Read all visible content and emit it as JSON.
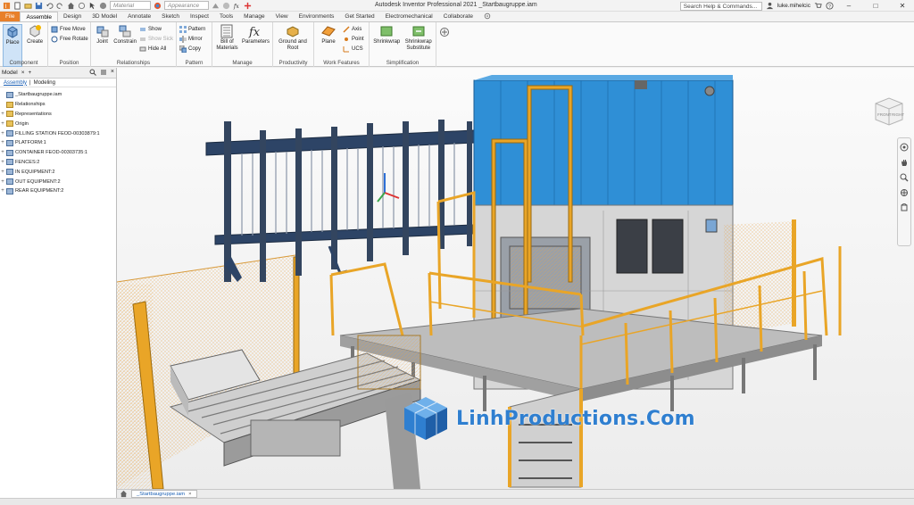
{
  "app": {
    "title": "Autodesk Inventor Professional 2021   _Startbaugruppe.iam",
    "material_placeholder": "Material",
    "appearance_placeholder": "Appearance",
    "search_placeholder": "Search Help & Commands...",
    "user": "luke.mihelcic"
  },
  "tabs": [
    "Assemble",
    "Design",
    "3D Model",
    "Annotate",
    "Sketch",
    "Inspect",
    "Tools",
    "Manage",
    "View",
    "Environments",
    "Get Started",
    "Electromechanical",
    "Collaborate"
  ],
  "file_tab": "File",
  "ribbon": {
    "component": {
      "label": "Component",
      "place": "Place",
      "create": "Create"
    },
    "position": {
      "label": "Position",
      "free_move": "Free Move",
      "free_rotate": "Free Rotate"
    },
    "relationships": {
      "label": "Relationships",
      "joint": "Joint",
      "constrain": "Constrain",
      "show": "Show",
      "show_sick": "Show Sick",
      "hide_all": "Hide All"
    },
    "pattern": {
      "label": "Pattern",
      "pattern": "Pattern",
      "mirror": "Mirror",
      "copy": "Copy"
    },
    "manage": {
      "label": "Manage",
      "bom": "Bill of",
      "bom2": "Materials",
      "parameters": "Parameters"
    },
    "productivity": {
      "label": "Productivity",
      "ground": "Ground and",
      "ground2": "Root"
    },
    "work_features": {
      "label": "Work Features",
      "plane": "Plane",
      "axis": "Axis",
      "point": "Point",
      "ucs": "UCS"
    },
    "simplification": {
      "label": "Simplification",
      "shrinkwrap": "Shrinkwrap",
      "shrinkwrap_sub": "Shrinkwrap",
      "shrinkwrap_sub2": "Substitute"
    }
  },
  "browser": {
    "title": "Model",
    "tab_assembly": "Assembly",
    "tab_modeling": "Modeling",
    "root": "_Startbaugruppe.iam",
    "nodes": [
      {
        "label": "Relationships",
        "type": "folder",
        "expandable": false
      },
      {
        "label": "Representations",
        "type": "folder",
        "expandable": true
      },
      {
        "label": "Origin",
        "type": "folder",
        "expandable": true
      },
      {
        "label": "FILLING STATION FEOD-00303879:1",
        "type": "assembly",
        "expandable": true
      },
      {
        "label": "PLATFORM:1",
        "type": "assembly",
        "expandable": true
      },
      {
        "label": "CONTAINER FEOD-00303735:1",
        "type": "assembly",
        "expandable": true
      },
      {
        "label": "FENCES:2",
        "type": "assembly",
        "expandable": true
      },
      {
        "label": "IN EQUIPMENT:2",
        "type": "assembly",
        "expandable": true
      },
      {
        "label": "OUT EQUIPMENT:2",
        "type": "assembly",
        "expandable": true
      },
      {
        "label": "REAR EQUIPMENT:2",
        "type": "assembly",
        "expandable": true
      }
    ]
  },
  "viewcube": {
    "front": "FRONT",
    "right": "RIGHT"
  },
  "watermark": "LinhProductions.Com",
  "doc_tab": "_Startbaugruppe.iam",
  "colors": {
    "accent_file": "#e8802a",
    "selection": "#cfe3f7",
    "housing_blue": "#2f8fd6",
    "railing_orange": "#e9a527",
    "watermark_blue": "#2f7fd0"
  }
}
